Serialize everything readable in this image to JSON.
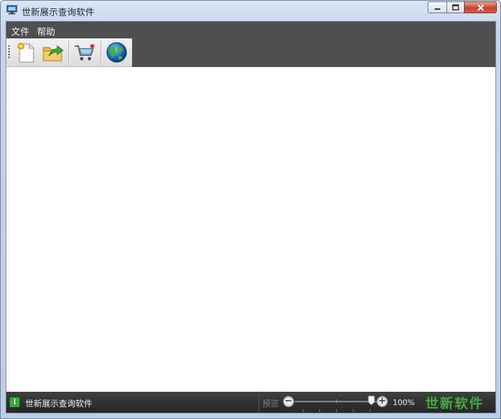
{
  "window": {
    "title": "世新展示查询软件",
    "controls": {
      "minimize": "minimize",
      "maximize": "maximize",
      "close": "close"
    }
  },
  "menu": {
    "items": [
      {
        "label": "文件"
      },
      {
        "label": "帮助"
      }
    ]
  },
  "toolbar": {
    "buttons": [
      {
        "icon": "new-document-icon"
      },
      {
        "icon": "open-folder-icon"
      },
      {
        "icon": "shopping-cart-icon"
      },
      {
        "icon": "globe-icon"
      }
    ]
  },
  "statusbar": {
    "text": "世新展示查询软件",
    "zoom_label": "预览",
    "zoom_value": "100%",
    "zoom_level_percent": 100,
    "brand": "世新软件"
  },
  "colors": {
    "menubar": "#4f4f4f",
    "statusbar": "#262626",
    "brand": "#3fae39"
  }
}
